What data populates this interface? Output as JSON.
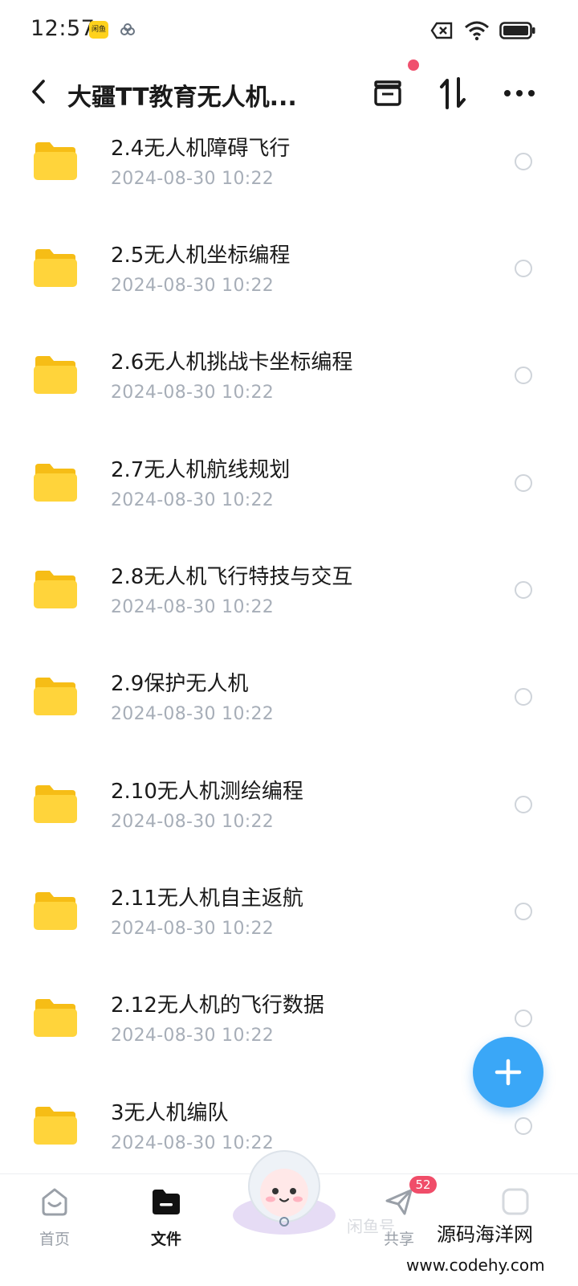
{
  "status_bar": {
    "time": "12:57",
    "app_badge": "闲鱼"
  },
  "header": {
    "title": "大疆TT教育无人机...",
    "back_icon": "chevron-left-icon",
    "archive_icon": "archive-box-icon",
    "sort_icon": "sort-arrows-icon",
    "more_icon": "more-dots-icon",
    "notification_dot_color": "#f0506e"
  },
  "files": [
    {
      "name": "2.4无人机障碍飞行",
      "date": "2024-08-30  10:22"
    },
    {
      "name": "2.5无人机坐标编程",
      "date": "2024-08-30  10:22"
    },
    {
      "name": "2.6无人机挑战卡坐标编程",
      "date": "2024-08-30  10:22"
    },
    {
      "name": "2.7无人机航线规划",
      "date": "2024-08-30  10:22"
    },
    {
      "name": "2.8无人机飞行特技与交互",
      "date": "2024-08-30  10:22"
    },
    {
      "name": "2.9保护无人机",
      "date": "2024-08-30  10:22"
    },
    {
      "name": "2.10无人机测绘编程",
      "date": "2024-08-30  10:22"
    },
    {
      "name": "2.11无人机自主返航",
      "date": "2024-08-30  10:22"
    },
    {
      "name": "2.12无人机的飞行数据",
      "date": "2024-08-30  10:22"
    },
    {
      "name": "3无人机编队",
      "date": "2024-08-30  10:22"
    }
  ],
  "fab": {
    "icon": "plus-icon",
    "color": "#3aa7f7"
  },
  "bottom_nav": {
    "home_label": "首页",
    "files_label": "文件",
    "share_label": "共享",
    "share_badge": "52"
  },
  "watermark": {
    "overlay": "闲鱼号",
    "site_name": "源码海洋网",
    "site_url": "www.codehy.com"
  },
  "colors": {
    "folder": "#ffd43b",
    "date_text": "#a7aeb8",
    "accent": "#3aa7f7",
    "badge": "#f04d69"
  }
}
